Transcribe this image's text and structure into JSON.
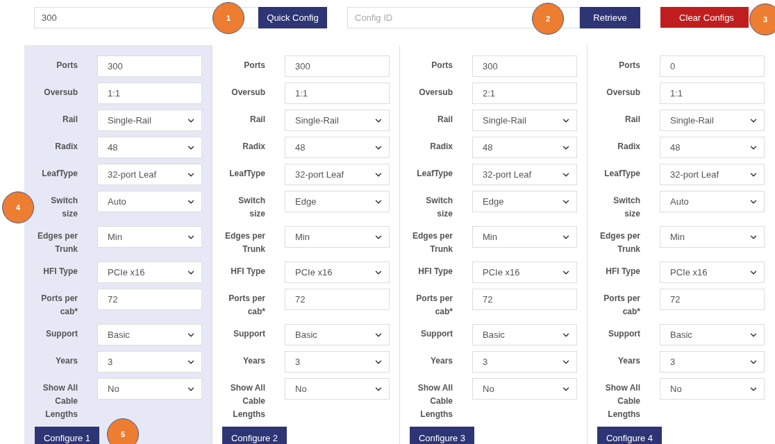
{
  "quick_config": {
    "value": "300",
    "button": "Quick Config"
  },
  "retrieve": {
    "placeholder": "Config ID",
    "button": "Retrieve"
  },
  "clear_button": "Clear Configs",
  "configs": [
    {
      "selected": true,
      "button": "Configure 1",
      "fields": [
        {
          "label": "Ports",
          "kind": "text",
          "value": "300"
        },
        {
          "label": "Oversub",
          "kind": "text",
          "value": "1:1"
        },
        {
          "label": "Rail",
          "kind": "select",
          "value": "Single-Rail"
        },
        {
          "label": "Radix",
          "kind": "select",
          "value": "48"
        },
        {
          "label": "LeafType",
          "kind": "select",
          "value": "32-port Leaf"
        },
        {
          "label": "Switch size",
          "kind": "select",
          "value": "Auto"
        },
        {
          "label": "Edges per Trunk",
          "kind": "select",
          "value": "Min"
        },
        {
          "label": "HFI Type",
          "kind": "select",
          "value": "PCIe x16"
        },
        {
          "label": "Ports per cab*",
          "kind": "text",
          "value": "72"
        },
        {
          "label": "Support",
          "kind": "select",
          "value": "Basic"
        },
        {
          "label": "Years",
          "kind": "select",
          "value": "3"
        },
        {
          "label": "Show All Cable Lengths",
          "kind": "select",
          "value": "No"
        }
      ]
    },
    {
      "selected": false,
      "button": "Configure 2",
      "fields": [
        {
          "label": "Ports",
          "kind": "text",
          "value": "300"
        },
        {
          "label": "Oversub",
          "kind": "text",
          "value": "1:1"
        },
        {
          "label": "Rail",
          "kind": "select",
          "value": "Single-Rail"
        },
        {
          "label": "Radix",
          "kind": "select",
          "value": "48"
        },
        {
          "label": "LeafType",
          "kind": "select",
          "value": "32-port Leaf"
        },
        {
          "label": "Switch size",
          "kind": "select",
          "value": "Edge"
        },
        {
          "label": "Edges per Trunk",
          "kind": "select",
          "value": "Min"
        },
        {
          "label": "HFI Type",
          "kind": "select",
          "value": "PCIe x16"
        },
        {
          "label": "Ports per cab*",
          "kind": "text",
          "value": "72"
        },
        {
          "label": "Support",
          "kind": "select",
          "value": "Basic"
        },
        {
          "label": "Years",
          "kind": "select",
          "value": "3"
        },
        {
          "label": "Show All Cable Lengths",
          "kind": "select",
          "value": "No"
        }
      ]
    },
    {
      "selected": false,
      "button": "Configure 3",
      "fields": [
        {
          "label": "Ports",
          "kind": "text",
          "value": "300"
        },
        {
          "label": "Oversub",
          "kind": "text",
          "value": "2:1"
        },
        {
          "label": "Rail",
          "kind": "select",
          "value": "Single-Rail"
        },
        {
          "label": "Radix",
          "kind": "select",
          "value": "48"
        },
        {
          "label": "LeafType",
          "kind": "select",
          "value": "32-port Leaf"
        },
        {
          "label": "Switch size",
          "kind": "select",
          "value": "Edge"
        },
        {
          "label": "Edges per Trunk",
          "kind": "select",
          "value": "Min"
        },
        {
          "label": "HFI Type",
          "kind": "select",
          "value": "PCIe x16"
        },
        {
          "label": "Ports per cab*",
          "kind": "text",
          "value": "72"
        },
        {
          "label": "Support",
          "kind": "select",
          "value": "Basic"
        },
        {
          "label": "Years",
          "kind": "select",
          "value": "3"
        },
        {
          "label": "Show All Cable Lengths",
          "kind": "select",
          "value": "No"
        }
      ]
    },
    {
      "selected": false,
      "button": "Configure 4",
      "fields": [
        {
          "label": "Ports",
          "kind": "text",
          "value": "0"
        },
        {
          "label": "Oversub",
          "kind": "text",
          "value": "1:1"
        },
        {
          "label": "Rail",
          "kind": "select",
          "value": "Single-Rail"
        },
        {
          "label": "Radix",
          "kind": "select",
          "value": "48"
        },
        {
          "label": "LeafType",
          "kind": "select",
          "value": "32-port Leaf"
        },
        {
          "label": "Switch size",
          "kind": "select",
          "value": "Auto"
        },
        {
          "label": "Edges per Trunk",
          "kind": "select",
          "value": "Min"
        },
        {
          "label": "HFI Type",
          "kind": "select",
          "value": "PCIe x16"
        },
        {
          "label": "Ports per cab*",
          "kind": "text",
          "value": "72"
        },
        {
          "label": "Support",
          "kind": "select",
          "value": "Basic"
        },
        {
          "label": "Years",
          "kind": "select",
          "value": "3"
        },
        {
          "label": "Show All Cable Lengths",
          "kind": "select",
          "value": "No"
        }
      ]
    }
  ],
  "callouts": [
    "1",
    "2",
    "3",
    "4",
    "5"
  ]
}
